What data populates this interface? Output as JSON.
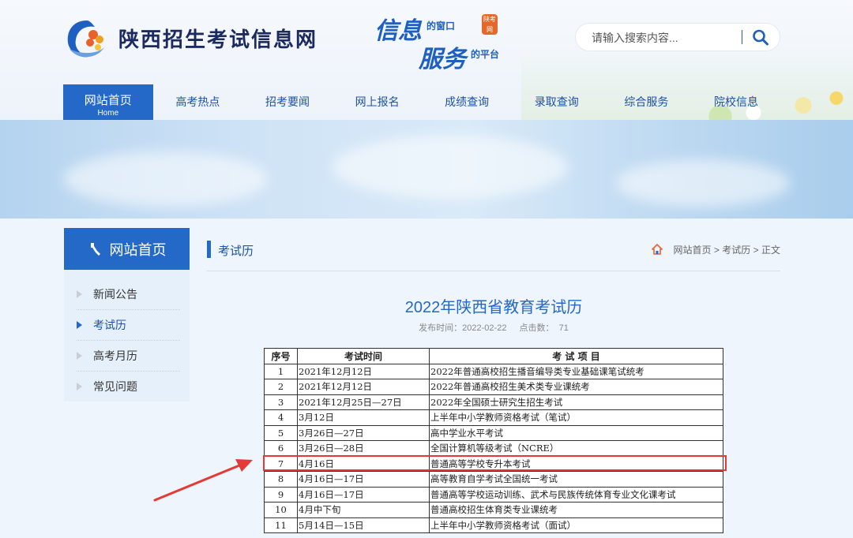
{
  "header": {
    "site_title": "陕西招生考试信息网",
    "slogan_line1": "信息",
    "slogan_small1": "的窗口",
    "slogan_line2": "服务",
    "slogan_small2": "的平台",
    "stamp": "陕考网"
  },
  "search": {
    "placeholder": "请输入搜索内容..."
  },
  "nav": {
    "home_label": "网站首页",
    "home_sub": "Home",
    "items": [
      "高考热点",
      "招考要闻",
      "网上报名",
      "成绩查询",
      "录取查询",
      "综合服务",
      "院校信息"
    ]
  },
  "sidebar": {
    "title": "网站首页",
    "items": [
      "新闻公告",
      "考试历",
      "高考月历",
      "常见问题"
    ],
    "active_index": 1
  },
  "section": {
    "title": "考试历",
    "breadcrumb": [
      "网站首页",
      ">",
      "考试历",
      ">",
      "正文"
    ]
  },
  "article": {
    "title": "2022年陕西省教育考试历",
    "publish_label": "发布时间：",
    "publish_date": "2022-02-22",
    "clicks_label": "点击数：",
    "clicks": "71"
  },
  "table": {
    "headers": [
      "序号",
      "考试时间",
      "考 试 项 目"
    ],
    "rows": [
      [
        "1",
        "2021年12月12日",
        "2022年普通高校招生播音编导类专业基础课笔试统考"
      ],
      [
        "2",
        "2021年12月12日",
        "2022年普通高校招生美术类专业课统考"
      ],
      [
        "3",
        "2021年12月25日—27日",
        "2022年全国硕士研究生招生考试"
      ],
      [
        "4",
        "3月12日",
        "上半年中小学教师资格考试（笔试）"
      ],
      [
        "5",
        "3月26日—27日",
        "高中学业水平考试"
      ],
      [
        "6",
        "3月26日—28日",
        "全国计算机等级考试（NCRE）"
      ],
      [
        "7",
        "4月16日",
        "普通高等学校专升本考试"
      ],
      [
        "8",
        "4月16日—17日",
        "高等教育自学考试全国统一考试"
      ],
      [
        "9",
        "4月16日—17日",
        "普通高等学校运动训练、武术与民族传统体育专业文化课考试"
      ],
      [
        "10",
        "4月中下旬",
        "普通高校招生体育类专业课统考"
      ],
      [
        "11",
        "5月14日—15日",
        "上半年中小学教师资格考试（面试）"
      ]
    ],
    "highlighted_row": 7
  },
  "colors": {
    "primary": "#2468c8",
    "nav_text": "#1e50a8",
    "highlight": "#e53935"
  }
}
